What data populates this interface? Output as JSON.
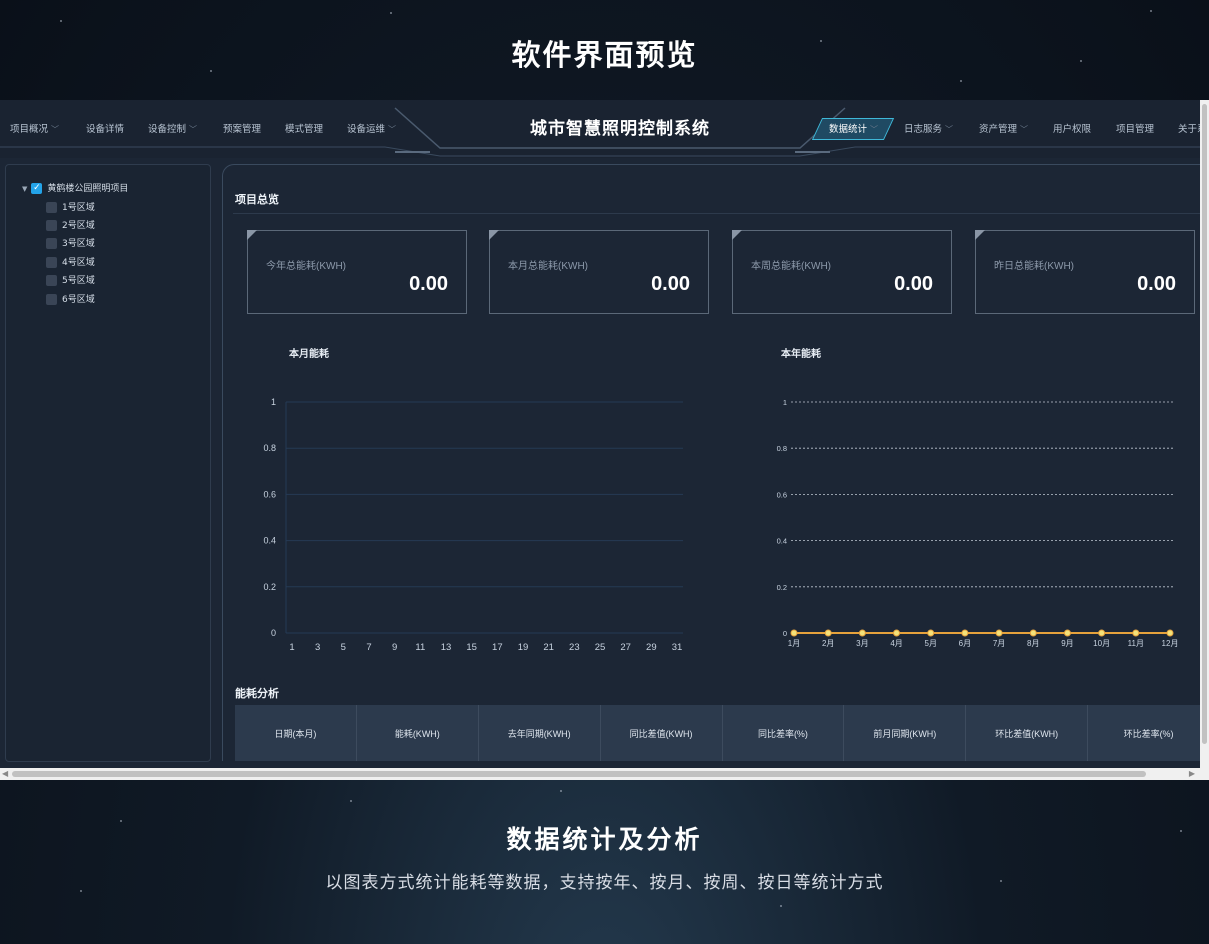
{
  "page": {
    "title": "软件界面预览",
    "section_title": "数据统计及分析",
    "section_desc": "以图表方式统计能耗等数据，支持按年、按月、按周、按日等统计方式"
  },
  "app": {
    "title": "城市智慧照明控制系统",
    "nav_left": [
      {
        "label": "项目概况",
        "has_dropdown": true
      },
      {
        "label": "设备详情",
        "has_dropdown": false
      },
      {
        "label": "设备控制",
        "has_dropdown": true
      },
      {
        "label": "预案管理",
        "has_dropdown": false
      },
      {
        "label": "模式管理",
        "has_dropdown": false
      },
      {
        "label": "设备运维",
        "has_dropdown": true
      }
    ],
    "nav_right": [
      {
        "label": "数据统计",
        "has_dropdown": true,
        "active": true
      },
      {
        "label": "日志服务",
        "has_dropdown": true
      },
      {
        "label": "资产管理",
        "has_dropdown": true
      },
      {
        "label": "用户权限",
        "has_dropdown": false
      },
      {
        "label": "项目管理",
        "has_dropdown": false
      },
      {
        "label": "关于系",
        "has_dropdown": false
      }
    ]
  },
  "sidebar": {
    "root": {
      "label": "黄鹤楼公园照明项目",
      "checked": true
    },
    "children": [
      "1号区域",
      "2号区域",
      "3号区域",
      "4号区域",
      "5号区域",
      "6号区域"
    ]
  },
  "overview": {
    "title": "项目总览",
    "cards": [
      {
        "label": "今年总能耗(KWH)",
        "value": "0.00"
      },
      {
        "label": "本月总能耗(KWH)",
        "value": "0.00"
      },
      {
        "label": "本周总能耗(KWH)",
        "value": "0.00"
      },
      {
        "label": "昨日总能耗(KWH)",
        "value": "0.00"
      }
    ]
  },
  "chart_data": [
    {
      "type": "line",
      "title": "本月能耗",
      "x_ticks": [
        "1",
        "3",
        "5",
        "7",
        "9",
        "11",
        "13",
        "15",
        "17",
        "19",
        "21",
        "23",
        "25",
        "27",
        "29",
        "31"
      ],
      "y_ticks": [
        "1",
        "0.8",
        "0.6",
        "0.4",
        "0.2",
        "0"
      ],
      "ylim": [
        0,
        1
      ],
      "series": [],
      "grid": true
    },
    {
      "type": "line",
      "title": "本年能耗",
      "categories": [
        "1月",
        "2月",
        "3月",
        "4月",
        "5月",
        "6月",
        "7月",
        "8月",
        "9月",
        "10月",
        "11月",
        "12月"
      ],
      "y_ticks": [
        "1",
        "0.8",
        "0.6",
        "0.4",
        "0.2",
        "0"
      ],
      "ylim": [
        0,
        1
      ],
      "series": [
        {
          "values": [
            0,
            0,
            0,
            0,
            0,
            0,
            0,
            0,
            0,
            0,
            0,
            0
          ]
        }
      ],
      "grid": true,
      "line_color": "#e6a23c"
    }
  ],
  "analysis": {
    "title": "能耗分析",
    "columns": [
      "日期(本月)",
      "能耗(KWH)",
      "去年同期(KWH)",
      "同比差值(KWH)",
      "同比差率(%)",
      "前月同期(KWH)",
      "环比差值(KWH)",
      "环比差率(%)"
    ]
  }
}
